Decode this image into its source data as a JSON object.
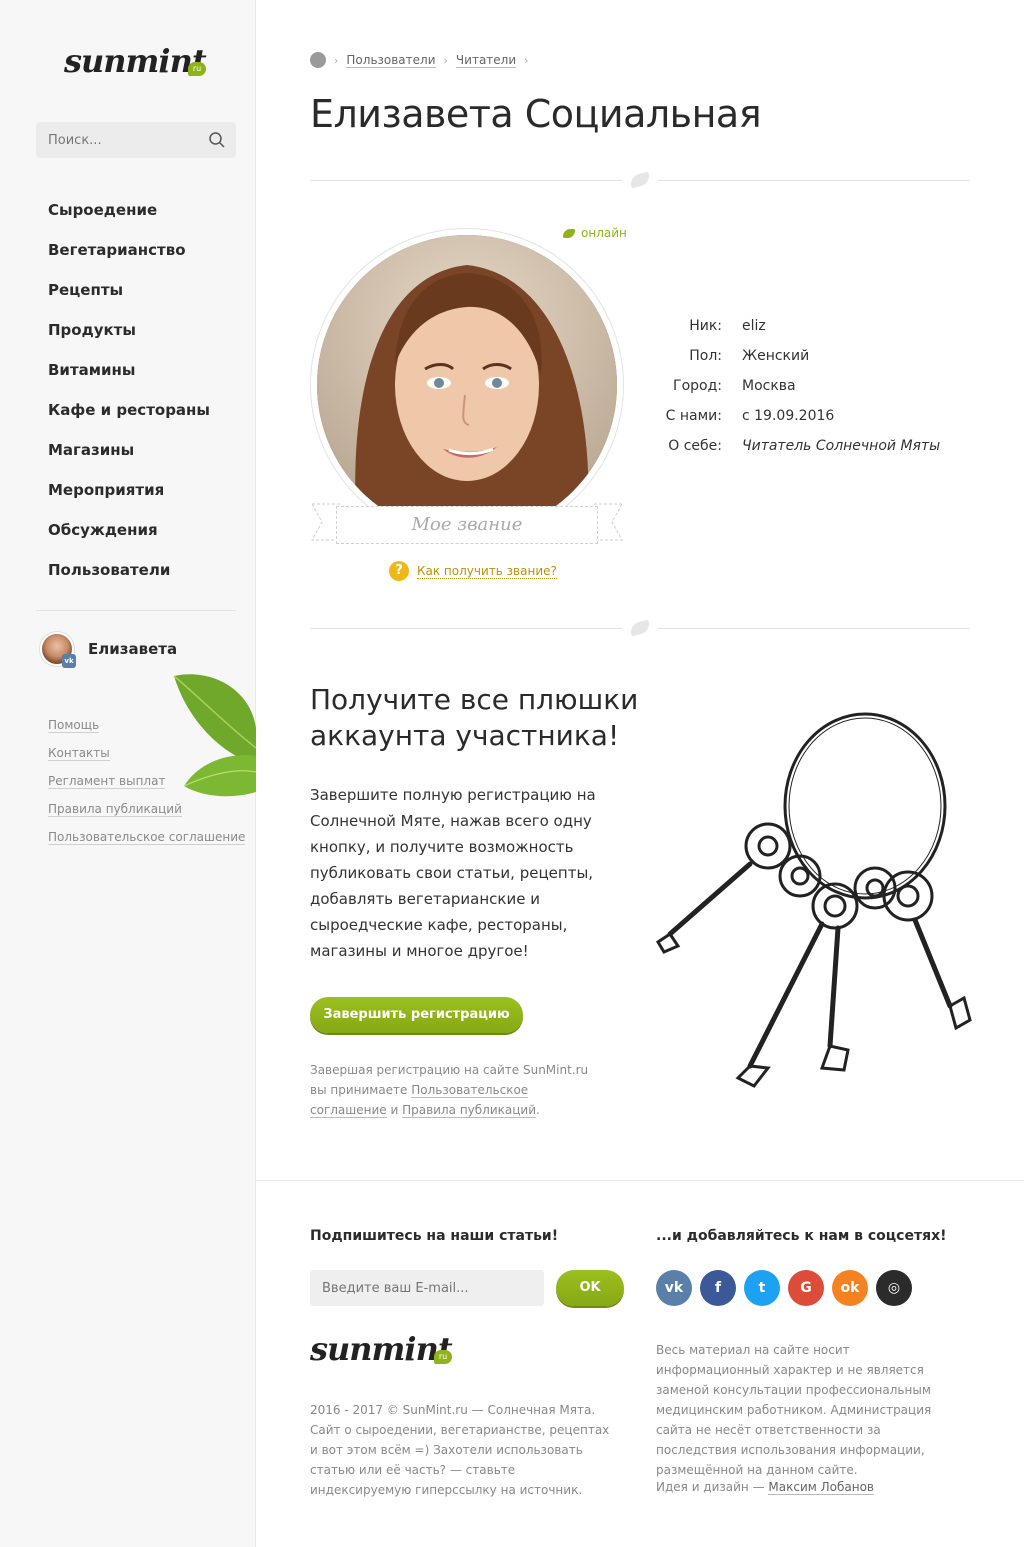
{
  "sidebar": {
    "logo_text": "sunmint",
    "logo_badge": "ru",
    "search_placeholder": "Поиск...",
    "nav": [
      {
        "label": "Сыроедение"
      },
      {
        "label": "Вегетарианство"
      },
      {
        "label": "Рецепты"
      },
      {
        "label": "Продукты"
      },
      {
        "label": "Витамины"
      },
      {
        "label": "Кафе и рестораны"
      },
      {
        "label": "Магазины"
      },
      {
        "label": "Мероприятия"
      },
      {
        "label": "Обсуждения"
      },
      {
        "label": "Пользователи"
      }
    ],
    "user_name": "Елизавета",
    "vk_badge": "vk",
    "links": [
      "Помощь",
      "Контакты",
      "Регламент выплат",
      "Правила публикаций",
      "Пользовательское соглашение"
    ]
  },
  "breadcrumb": [
    "Пользователи",
    "Читатели"
  ],
  "profile": {
    "name": "Елизавета Социальная",
    "status": "онлайн",
    "rank_placeholder": "Мое звание",
    "rank_help": "Как получить звание?",
    "rank_help_icon": "?",
    "fields": [
      {
        "key": "Ник:",
        "value": "eliz",
        "italic": false
      },
      {
        "key": "Пол:",
        "value": "Женский",
        "italic": false
      },
      {
        "key": "Город:",
        "value": "Москва",
        "italic": false
      },
      {
        "key": "С нами:",
        "value": "с 19.09.2016",
        "italic": false
      },
      {
        "key": "О себе:",
        "value": "Читатель Солнечной Мяты",
        "italic": true
      }
    ]
  },
  "promo": {
    "title": "Получите все плюшки аккаунта участника!",
    "text": "Завершите полную регистрацию на Солнечной Мяте, нажав всего одну кнопку, и получите возможность публиковать свои статьи, рецепты, добавлять вегетарианские и сыроедческие кафе, рестораны, магазины и многое другое!",
    "button": "Завершить регистрацию",
    "legal_1": "Завершая регистрацию на сайте SunMint.ru вы принимаете ",
    "legal_link_1": "Пользовательское соглашение",
    "legal_2": " и ",
    "legal_link_2": "Правила публикаций",
    "legal_3": "."
  },
  "footer": {
    "subscribe_title": "Подпишитесь на наши статьи!",
    "email_placeholder": "Введите ваш E-mail...",
    "ok_button": "OK",
    "social_title": "...и добавляйтесь к нам в соцсетях!",
    "socials": [
      {
        "name": "vk-icon",
        "glyph": "vk",
        "color": "#5a7fa8"
      },
      {
        "name": "facebook-icon",
        "glyph": "f",
        "color": "#3b5998"
      },
      {
        "name": "twitter-icon",
        "glyph": "t",
        "color": "#1da1f2"
      },
      {
        "name": "google-icon",
        "glyph": "G",
        "color": "#dd4b39"
      },
      {
        "name": "odnoklassniki-icon",
        "glyph": "ok",
        "color": "#f58220"
      },
      {
        "name": "instagram-icon",
        "glyph": "◎",
        "color": "#2b2b2b"
      }
    ],
    "copyright": "2016 - 2017 © SunMint.ru — Солнечная Мята.",
    "about": "Сайт о сыроедении, вегетарианстве, рецептах и вот этом всём =) Захотели использовать статью или её часть? — ставьте индексируемую гиперссылку на источник.",
    "disclaimer": "Весь материал на сайте носит информационный характер и не является заменой консультации профессиональным медицинским работником. Администрация сайта не несёт ответственности за последствия использования информации, размещённой на данном сайте.",
    "design_label": "Идея и дизайн — ",
    "design_author": "Максим Лобанов"
  },
  "colors": {
    "accent": "#8fb31b",
    "help": "#f0b816"
  }
}
